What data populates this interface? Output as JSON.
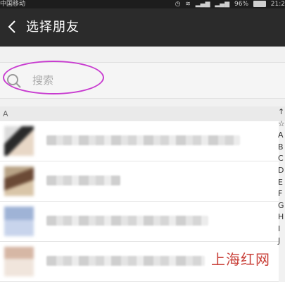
{
  "status_bar": {
    "carrier": "中国移动",
    "battery": "96%",
    "time": "21:2"
  },
  "nav": {
    "title": "选择朋友"
  },
  "search": {
    "placeholder": "搜索"
  },
  "section": {
    "letter": "A"
  },
  "index_letters": [
    "↑",
    "☆",
    "A",
    "B",
    "C",
    "D",
    "E",
    "F",
    "G",
    "H",
    "I",
    "J"
  ],
  "watermark": "上海红网",
  "colors": {
    "nav_bg": "#2b2b2b",
    "annotation_oval": "#c83bd0",
    "watermark": "#c9413a"
  }
}
